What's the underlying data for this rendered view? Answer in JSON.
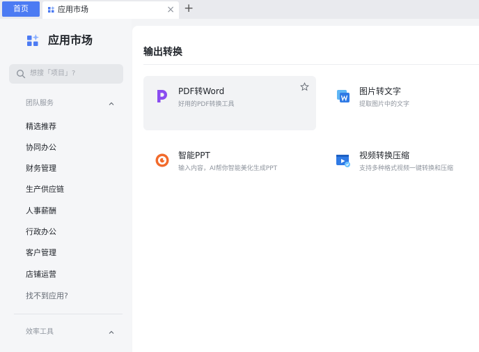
{
  "tabbar": {
    "home_label": "首页",
    "active_tab_label": "应用市场",
    "close_glyph": "×",
    "add_glyph": "+"
  },
  "sidebar": {
    "title": "应用市场",
    "search_placeholder": "想搜「项目」?",
    "groups": [
      {
        "title": "团队服务",
        "expanded": true,
        "items": [
          "精选推荐",
          "协同办公",
          "财务管理",
          "生产供应链",
          "人事薪酬",
          "行政办公",
          "客户管理",
          "店铺运营"
        ]
      },
      {
        "title": "效率工具",
        "expanded": true,
        "items": []
      }
    ],
    "not_found_label": "找不到应用?"
  },
  "main": {
    "section_title": "输出转换",
    "apps": [
      {
        "name": "PDF转Word",
        "desc": "好用的PDF转换工具",
        "icon": "pdf-logo-icon",
        "hovered": true
      },
      {
        "name": "图片转文字",
        "desc": "提取图片中的文字",
        "icon": "image-to-text-icon",
        "hovered": false
      },
      {
        "name": "智能PPT",
        "desc": "输入内容，AI帮你智能美化生成PPT",
        "icon": "smart-ppt-icon",
        "hovered": false
      },
      {
        "name": "视频转换压缩",
        "desc": "支持多种格式视频一键转换和压缩",
        "icon": "video-convert-icon",
        "hovered": false
      }
    ]
  },
  "colors": {
    "accent": "#4c7bf3",
    "pdf_purple": "#8a4cf0",
    "ppt_orange": "#f26b2c",
    "icon_blue": "#2f7ae5"
  }
}
